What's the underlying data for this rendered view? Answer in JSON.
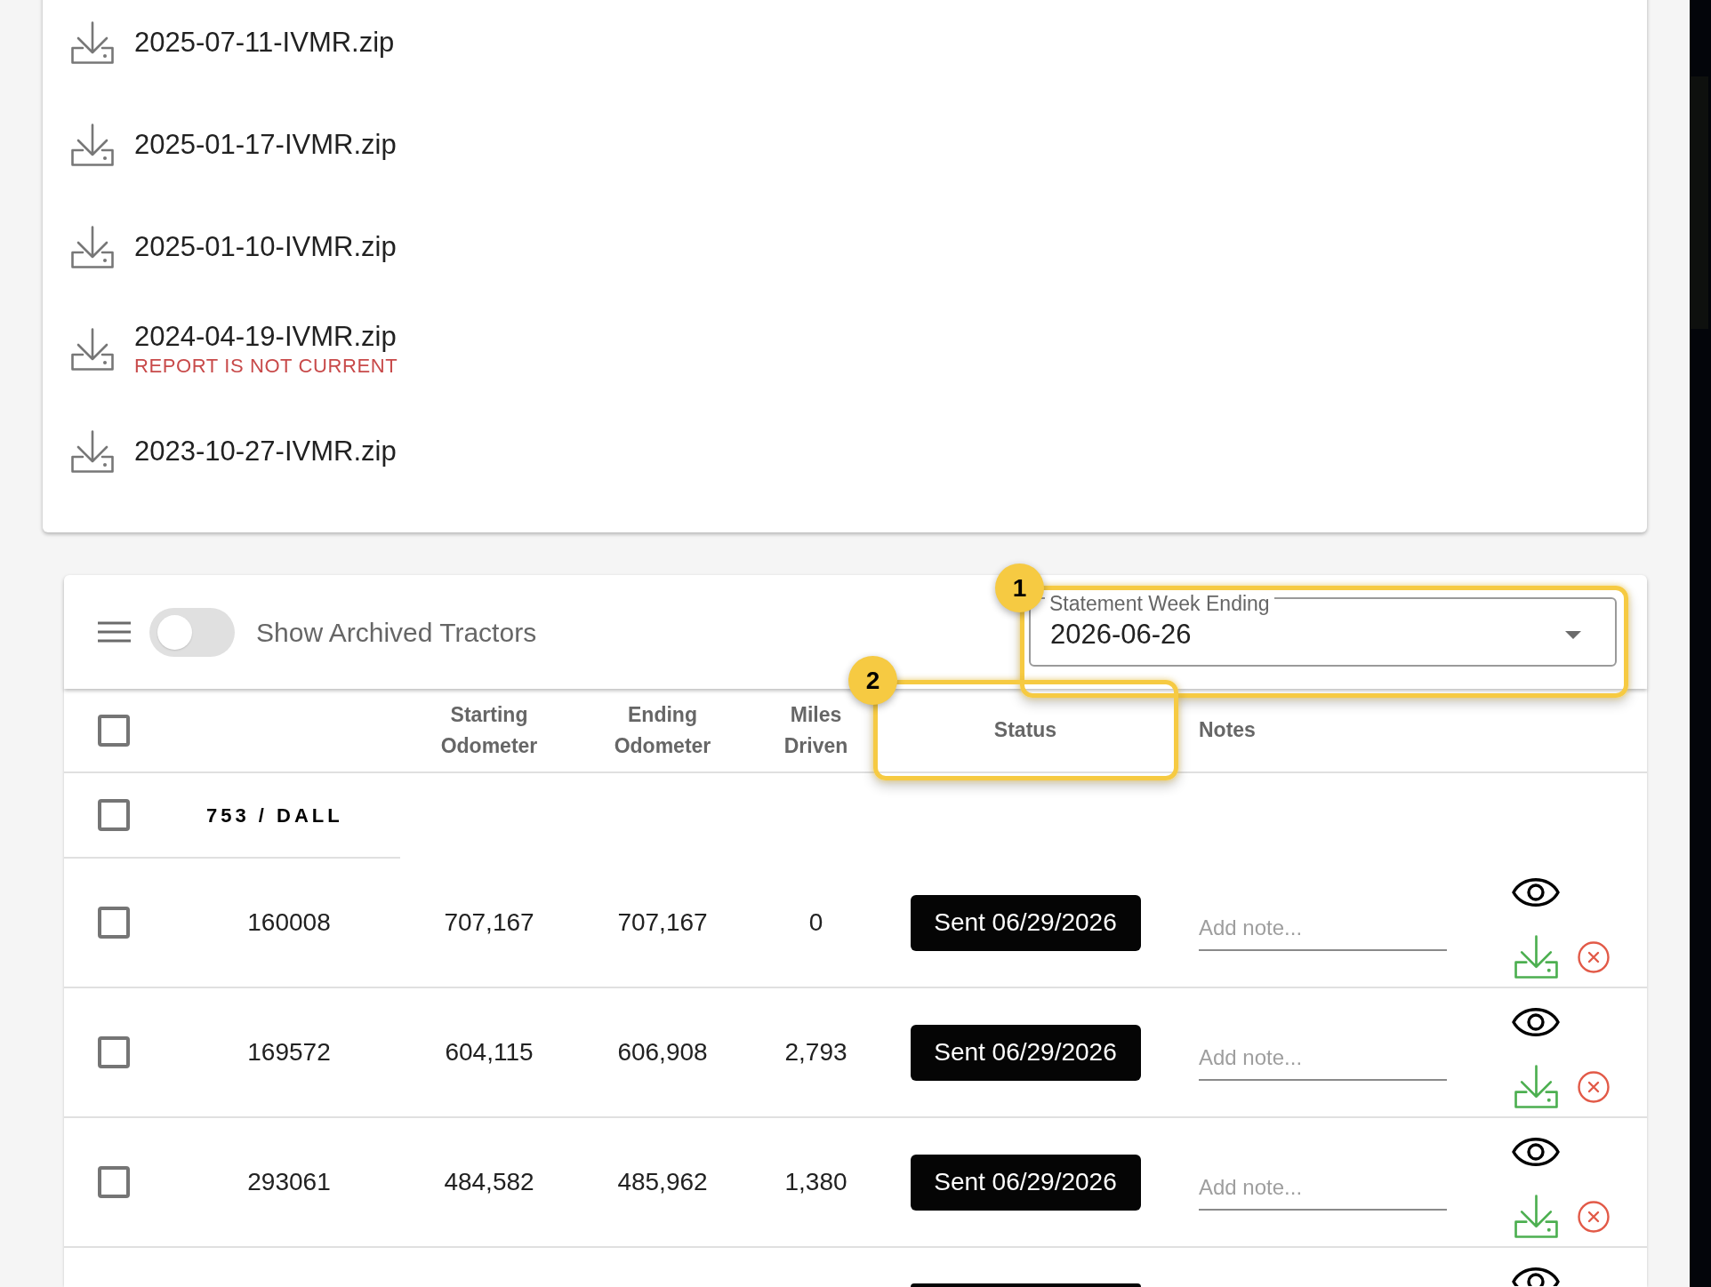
{
  "files": [
    {
      "name": "2025-07-11-IVMR.zip"
    },
    {
      "name": "2025-01-17-IVMR.zip"
    },
    {
      "name": "2025-01-10-IVMR.zip"
    },
    {
      "name": "2024-04-19-IVMR.zip",
      "warning": "REPORT IS NOT CURRENT"
    },
    {
      "name": "2023-10-27-IVMR.zip"
    }
  ],
  "toolbar": {
    "archived_toggle": {
      "label": "Show Archived Tractors",
      "on": false
    },
    "week_select": {
      "label": "Statement Week Ending",
      "value": "2026-06-26",
      "callout": "1"
    }
  },
  "table": {
    "select_all": {
      "checked": false
    },
    "columns": [
      {
        "label": "Starting Odometer"
      },
      {
        "label": "Ending Odometer"
      },
      {
        "label": "Miles Driven"
      },
      {
        "label": "Status",
        "callout": "2"
      },
      {
        "label": "Notes"
      }
    ],
    "groups": [
      {
        "name": "753 / DALL",
        "checked": false,
        "rows": [
          {
            "checked": false,
            "tractor": "160008",
            "starting_odometer": "707,167",
            "ending_odometer": "707,167",
            "miles_driven": "0",
            "status": "Sent 06/29/2026",
            "note": {
              "placeholder": "Add note..."
            }
          },
          {
            "checked": false,
            "tractor": "169572",
            "starting_odometer": "604,115",
            "ending_odometer": "606,908",
            "miles_driven": "2,793",
            "status": "Sent 06/29/2026",
            "note": {
              "placeholder": "Add note..."
            }
          },
          {
            "checked": false,
            "tractor": "293061",
            "starting_odometer": "484,582",
            "ending_odometer": "485,962",
            "miles_driven": "1,380",
            "status": "Sent 06/29/2026",
            "note": {
              "placeholder": "Add note..."
            }
          }
        ]
      }
    ],
    "cut_off_row": true
  }
}
